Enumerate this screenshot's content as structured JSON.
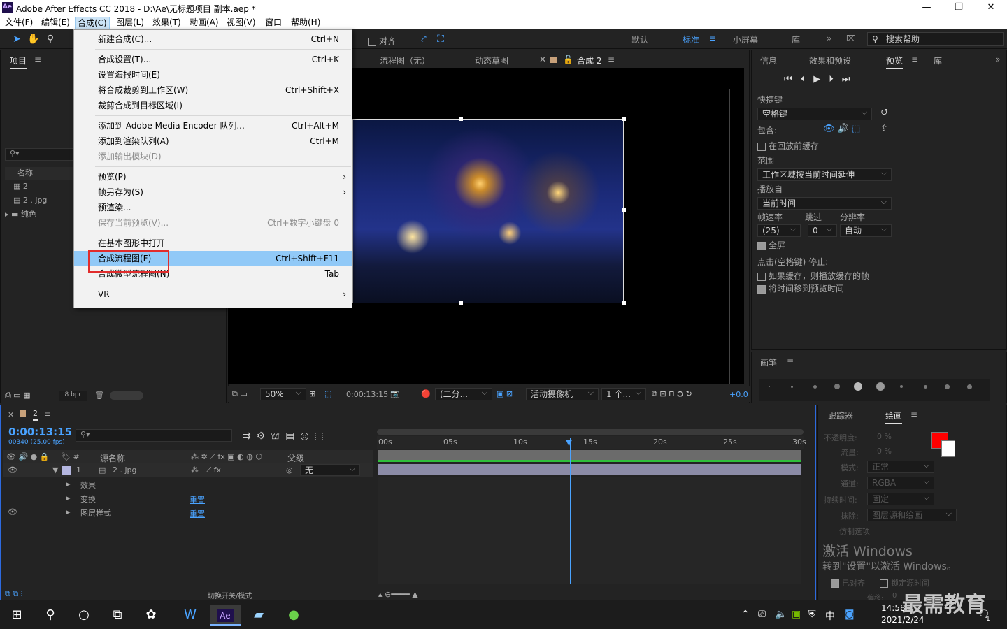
{
  "window": {
    "title": "Adobe After Effects CC 2018 - D:\\Ae\\无标题项目 副本.aep *",
    "app_icon": "Ae"
  },
  "menubar": [
    "文件(F)",
    "编辑(E)",
    "合成(C)",
    "图层(L)",
    "效果(T)",
    "动画(A)",
    "视图(V)",
    "窗口",
    "帮助(H)"
  ],
  "toolbar": {
    "snap_label": "对齐",
    "workspaces": [
      "默认",
      "标准",
      "小屏幕",
      "库"
    ],
    "active_workspace": "标准",
    "search_placeholder": "搜索帮助"
  },
  "composition_menu": [
    {
      "label": "新建合成(C)...",
      "shortcut": "Ctrl+N"
    },
    {
      "sep": true
    },
    {
      "label": "合成设置(T)...",
      "shortcut": "Ctrl+K"
    },
    {
      "label": "设置海报时间(E)",
      "shortcut": ""
    },
    {
      "label": "将合成裁剪到工作区(W)",
      "shortcut": "Ctrl+Shift+X"
    },
    {
      "label": "裁剪合成到目标区域(I)",
      "shortcut": ""
    },
    {
      "sep": true
    },
    {
      "label": "添加到 Adobe Media Encoder 队列...",
      "shortcut": "Ctrl+Alt+M"
    },
    {
      "label": "添加到渲染队列(A)",
      "shortcut": "Ctrl+M"
    },
    {
      "label": "添加输出模块(D)",
      "shortcut": "",
      "disabled": true
    },
    {
      "sep": true
    },
    {
      "label": "预览(P)",
      "shortcut": "",
      "submenu": true
    },
    {
      "label": "帧另存为(S)",
      "shortcut": "",
      "submenu": true
    },
    {
      "label": "预渲染...",
      "shortcut": ""
    },
    {
      "label": "保存当前预览(V)...",
      "shortcut": "Ctrl+数字小键盘 0",
      "disabled": true
    },
    {
      "sep": true
    },
    {
      "label": "在基本图形中打开",
      "shortcut": ""
    },
    {
      "label": "合成流程图(F)",
      "shortcut": "Ctrl+Shift+F11",
      "highlighted": true
    },
    {
      "label": "合成微型流程图(N)",
      "shortcut": "Tab"
    },
    {
      "sep": true
    },
    {
      "label": "VR",
      "shortcut": "",
      "submenu": true
    }
  ],
  "project": {
    "tab": "项目",
    "col_name": "名称",
    "items": [
      "2",
      "2 . jpg",
      "纯色"
    ],
    "bpc": "8 bpc"
  },
  "viewer": {
    "tabs": [
      "流程图（无）",
      "动态草图",
      "合成 2"
    ],
    "zoom": "50%",
    "timecode": "0:00:13:15",
    "resolution": "(二分...",
    "camera": "活动摄像机",
    "views": "1 个...",
    "offset": "+0.0"
  },
  "right_panel": {
    "tabs": [
      "信息",
      "效果和预设",
      "预览",
      "库"
    ],
    "active": "预览",
    "shortcut_label": "快捷键",
    "shortcut_value": "空格键",
    "include_label": "包含:",
    "cache_before": "在回放前缓存",
    "range_label": "范围",
    "range_value": "工作区域按当前时间延伸",
    "play_from_label": "播放自",
    "play_from_value": "当前时间",
    "fps_label": "帧速率",
    "skip_label": "跳过",
    "res_label": "分辨率",
    "fps_value": "(25)",
    "skip_value": "0",
    "res_value": "自动",
    "fullscreen": "全屏",
    "stop_label": "点击(空格键) 停止:",
    "if_cached": "如果缓存，则播放缓存的帧",
    "move_time": "将时间移到预览时间",
    "brush_tab": "画笔"
  },
  "timeline": {
    "comp_tab": "2",
    "timecode": "0:00:13:15",
    "frames": "00340 (25.00 fps)",
    "col_source": "源名称",
    "col_parent": "父级",
    "parent_value": "无",
    "layer_num": "1",
    "layer_name": "2 . jpg",
    "sub": [
      "效果",
      "变换",
      "图层样式"
    ],
    "reset": "重置",
    "ticks": [
      "00s",
      "05s",
      "10s",
      "15s",
      "20s",
      "25s",
      "30s"
    ],
    "switch_label": "切换开关/模式"
  },
  "paint": {
    "tabs": [
      "跟踪器",
      "绘画"
    ],
    "opacity_label": "不透明度:",
    "opacity": "0 %",
    "flow_label": "流量:",
    "flow": "0 %",
    "mode_label": "模式:",
    "mode": "正常",
    "channel_label": "通道:",
    "channel": "RGBA",
    "duration_label": "持续时间:",
    "duration": "固定",
    "erase_label": "抹除:",
    "erase": "图层源和绘画",
    "clone_label": "仿制选项",
    "aligned": "已对齐",
    "lock_source": "锁定源时间",
    "offset_label": "偏移:",
    "offset": "0",
    "fg_color": "#ff0000",
    "bg_color": "#ffffff"
  },
  "watermark": {
    "activate": "激活 Windows",
    "goto": "转到\"设置\"以激活 Windows。",
    "brand": "最需教育"
  },
  "taskbar": {
    "time": "14:58",
    "date": "2021/2/24",
    "ime": "中",
    "notifications": "1"
  }
}
